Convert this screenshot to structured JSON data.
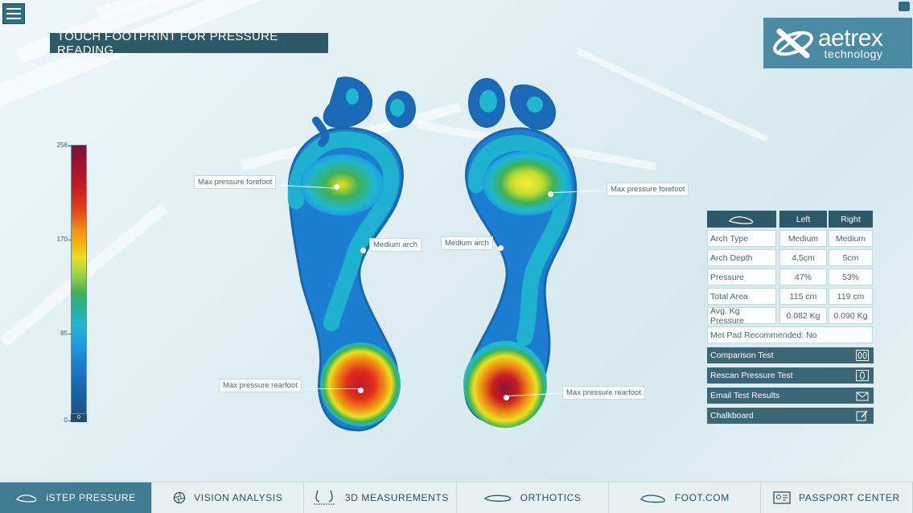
{
  "header": {
    "title": "TOUCH FOOTPRINT FOR PRESSURE READING",
    "menu_icon": "hamburger-menu-icon"
  },
  "logo": {
    "word": "aetrex",
    "sub": "technology"
  },
  "scale": {
    "ticks": [
      "256",
      "170",
      "85",
      "0"
    ],
    "zero_badge": "0",
    "colors": [
      "#7a1535",
      "#c81c20",
      "#f08a15",
      "#e9e11e",
      "#3fb255",
      "#1fb8cf",
      "#1b7ed0",
      "#1b5285"
    ]
  },
  "annotations": {
    "left_forefoot": "Max pressure forefoot",
    "left_arch": "Medium arch",
    "left_rearfoot": "Max pressure rearfoot",
    "right_forefoot": "Max pressure forefoot",
    "right_arch": "Medium arch",
    "right_rearfoot": "Max pressure rearfoot"
  },
  "results": {
    "head_icon": "foot-outline-icon",
    "col_left": "Left",
    "col_right": "Right",
    "rows": [
      {
        "label": "Arch Type",
        "left": "Medium",
        "right": "Medium"
      },
      {
        "label": "Arch Depth",
        "left": "4.5cm",
        "right": "5cm"
      },
      {
        "label": "Pressure",
        "left": "47%",
        "right": "53%"
      },
      {
        "label": "Total Area",
        "left": "115 cm",
        "right": "119 cm"
      },
      {
        "label": "Avg. Kg Pressure",
        "left": "0.082 Kg",
        "right": "0.090 Kg"
      }
    ],
    "met_pad_label": "Met Pad Recommended:",
    "met_pad_value": "No"
  },
  "actions": [
    {
      "label": "Comparison Test",
      "icon": "compare-feet-icon"
    },
    {
      "label": "Rescan Pressure Test",
      "icon": "rescan-foot-icon"
    },
    {
      "label": "Email Test Results",
      "icon": "envelope-icon"
    },
    {
      "label": "Chalkboard",
      "icon": "edit-pencil-icon"
    }
  ],
  "nav": [
    {
      "label": "iSTEP PRESSURE",
      "icon": "istep-pressure-icon",
      "active": true
    },
    {
      "label": "VISION ANALYSIS",
      "icon": "vision-aperture-icon",
      "active": false
    },
    {
      "label": "3D MEASUREMENTS",
      "icon": "3d-measurement-icon",
      "active": false
    },
    {
      "label": "ORTHOTICS",
      "icon": "orthotic-insole-icon",
      "active": false
    },
    {
      "label": "FOOT.COM",
      "icon": "foot-shoe-icon",
      "active": false
    },
    {
      "label": "PASSPORT CENTER",
      "icon": "passport-card-icon",
      "active": false
    }
  ]
}
